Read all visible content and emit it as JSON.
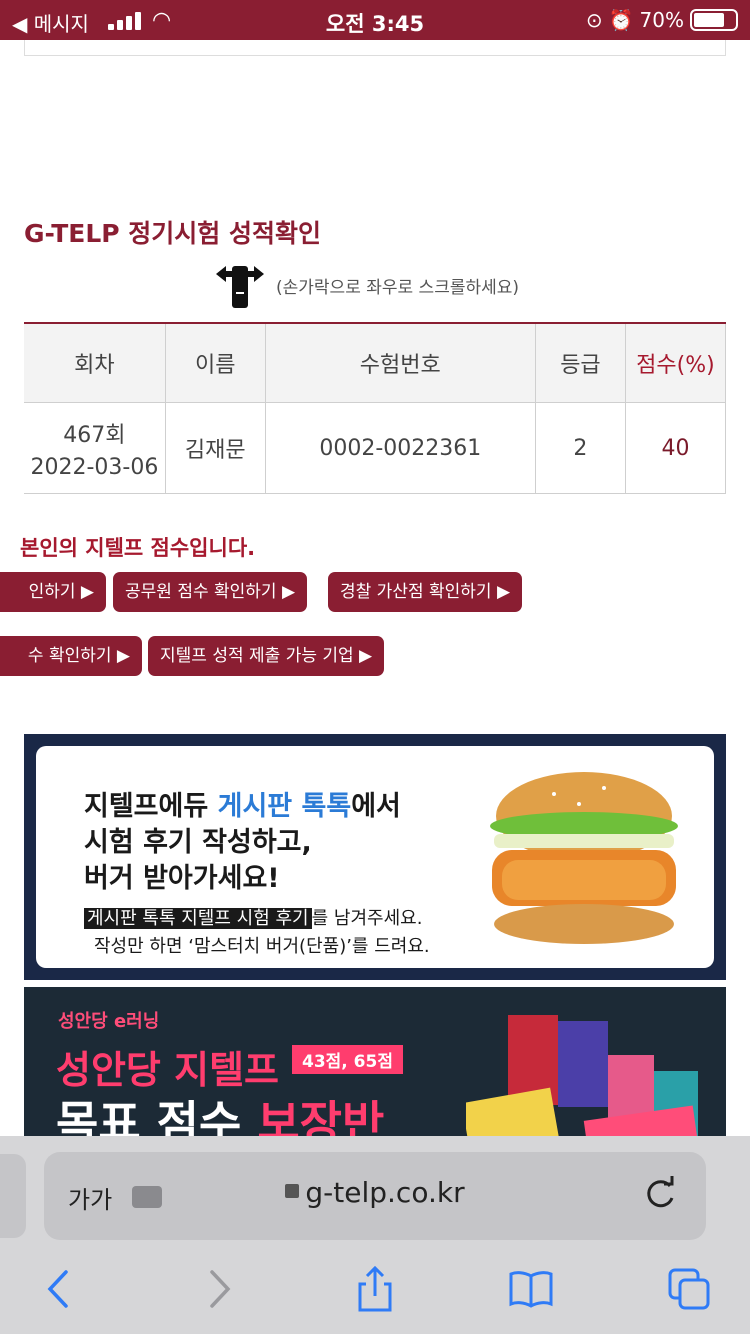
{
  "status_bar": {
    "back_app": "◀ 메시지",
    "time": "오전 3:45",
    "battery": "70%"
  },
  "page": {
    "title": "G-TELP 정기시험 성적확인",
    "scroll_hint": "(손가락으로 좌우로 스크롤하세요)",
    "table": {
      "headers": [
        "회차",
        "이름",
        "수험번호",
        "등급",
        "점수(%)"
      ],
      "row": {
        "session": "467회",
        "date": "2022-03-06",
        "name": "김재문",
        "exam_number": "0002-0022361",
        "grade": "2",
        "score": "40"
      }
    },
    "notice": "본인의 지텔프 점수입니다.",
    "buttons_row1": [
      "인하기 ▶",
      "공무원 점수 확인하기 ▶",
      "경찰 가산점 확인하기 ▶"
    ],
    "buttons_row2": [
      "수 확인하기 ▶",
      "지텔프 성적 제출 가능 기업 ▶"
    ]
  },
  "banner1": {
    "line1_a": "지텔프에듀 ",
    "line1_b": "게시판 톡톡",
    "line1_c": "에서",
    "line2": "시험 후기 작성하고,",
    "line3": "버거 받아가세요!",
    "sub1_hl": "게시판 톡톡 지텔프 시험 후기",
    "sub1_rest": "를 남겨주세요.",
    "sub2": "작성만 하면 ‘맘스터치 버거(단품)’를 드려요."
  },
  "banner2": {
    "logo": "성안당 e러닝",
    "title": "성안당 지텔프",
    "badge": "43점, 65점",
    "sub_a": "목표 점수 ",
    "sub_b": "보장반"
  },
  "browser": {
    "text_size": "가가",
    "url": "g-telp.co.kr"
  },
  "colors": {
    "brand": "#8a1e32",
    "accent_red": "#a6192e",
    "link_blue": "#2b7bd6",
    "ios_blue": "#2f7bf6"
  },
  "icons": [
    "signal-icon",
    "wifi-icon",
    "alarm-icon",
    "battery-icon",
    "swipe-hand-icon",
    "lock-icon",
    "puzzle-icon",
    "reload-icon",
    "back-arrow-icon",
    "forward-arrow-icon",
    "share-icon",
    "bookmarks-icon",
    "tabs-icon"
  ]
}
